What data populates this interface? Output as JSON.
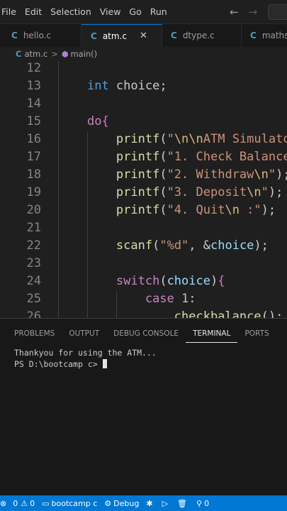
{
  "menu": [
    "File",
    "Edit",
    "Selection",
    "View",
    "Go",
    "Run"
  ],
  "nav": {
    "back_icon": "arrow-left-icon",
    "forward_icon": "arrow-right-icon"
  },
  "tabs": [
    {
      "label": "hello.c",
      "icon": "C",
      "active": false
    },
    {
      "label": "atm.c",
      "icon": "C",
      "active": true,
      "close": "✕"
    },
    {
      "label": "dtype.c",
      "icon": "C",
      "active": false
    },
    {
      "label": "mathss",
      "icon": "C",
      "active": false
    }
  ],
  "breadcrumb": {
    "file": "atm.c",
    "file_icon": "C",
    "symbol": "main()"
  },
  "editor": {
    "lines": [
      {
        "num": "12",
        "tokens": []
      },
      {
        "num": "13",
        "tokens": [
          [
            "    ",
            "p"
          ],
          [
            "int",
            "kw"
          ],
          [
            " choice;",
            "p"
          ]
        ]
      },
      {
        "num": "14",
        "tokens": []
      },
      {
        "num": "15",
        "tokens": [
          [
            "    ",
            "p"
          ],
          [
            "do",
            "ctrl"
          ],
          [
            "{",
            "br"
          ]
        ]
      },
      {
        "num": "16",
        "tokens": [
          [
            "        ",
            "p"
          ],
          [
            "printf",
            "fn"
          ],
          [
            "(",
            "p"
          ],
          [
            "\"",
            "str"
          ],
          [
            "\\n\\n",
            "esc"
          ],
          [
            "ATM Simulator",
            "str"
          ]
        ]
      },
      {
        "num": "17",
        "tokens": [
          [
            "        ",
            "p"
          ],
          [
            "printf",
            "fn"
          ],
          [
            "(",
            "p"
          ],
          [
            "\"1. Check Balance",
            "str"
          ]
        ]
      },
      {
        "num": "18",
        "tokens": [
          [
            "        ",
            "p"
          ],
          [
            "printf",
            "fn"
          ],
          [
            "(",
            "p"
          ],
          [
            "\"2. Withdraw",
            "str"
          ],
          [
            "\\n",
            "esc"
          ],
          [
            "\"",
            "str"
          ],
          [
            ");",
            "p"
          ]
        ]
      },
      {
        "num": "19",
        "tokens": [
          [
            "        ",
            "p"
          ],
          [
            "printf",
            "fn"
          ],
          [
            "(",
            "p"
          ],
          [
            "\"3. Deposit",
            "str"
          ],
          [
            "\\n",
            "esc"
          ],
          [
            "\"",
            "str"
          ],
          [
            ");",
            "p"
          ]
        ]
      },
      {
        "num": "20",
        "tokens": [
          [
            "        ",
            "p"
          ],
          [
            "printf",
            "fn"
          ],
          [
            "(",
            "p"
          ],
          [
            "\"4. Quit",
            "str"
          ],
          [
            "\\n",
            "esc"
          ],
          [
            " :\"",
            "str"
          ],
          [
            ");",
            "p"
          ]
        ]
      },
      {
        "num": "21",
        "tokens": []
      },
      {
        "num": "22",
        "tokens": [
          [
            "        ",
            "p"
          ],
          [
            "scanf",
            "fn"
          ],
          [
            "(",
            "p"
          ],
          [
            "\"%d\"",
            "str"
          ],
          [
            ", &",
            "p"
          ],
          [
            "choice",
            "var"
          ],
          [
            ");",
            "p"
          ]
        ]
      },
      {
        "num": "23",
        "tokens": []
      },
      {
        "num": "24",
        "tokens": [
          [
            "        ",
            "p"
          ],
          [
            "switch",
            "ctrl"
          ],
          [
            "(",
            "p"
          ],
          [
            "choice",
            "var"
          ],
          [
            ")",
            "p"
          ],
          [
            "{",
            "br"
          ]
        ]
      },
      {
        "num": "25",
        "tokens": [
          [
            "            ",
            "p"
          ],
          [
            "case",
            "ctrl"
          ],
          [
            " ",
            "p"
          ],
          [
            "1",
            "num"
          ],
          [
            ":",
            "p"
          ]
        ]
      },
      {
        "num": "26",
        "tokens": [
          [
            "                ",
            "p"
          ],
          [
            "checkbalance",
            "fn"
          ],
          [
            "();",
            "p"
          ]
        ]
      }
    ]
  },
  "panel": {
    "tabs": [
      {
        "label": "PROBLEMS",
        "active": false
      },
      {
        "label": "OUTPUT",
        "active": false
      },
      {
        "label": "DEBUG CONSOLE",
        "active": false
      },
      {
        "label": "TERMINAL",
        "active": true
      },
      {
        "label": "PORTS",
        "active": false
      }
    ],
    "terminal": {
      "line1": "Thankyou for using the ATM...",
      "prompt": "PS D:\\bootcamp c> "
    }
  },
  "statusbar": {
    "remote_icon": "remote-icon",
    "errors": "0",
    "warnings": "0",
    "folder": "bootcamp c",
    "debug": "Debug",
    "ports": "0"
  },
  "colors": {
    "status_bar": "#0078d4",
    "editor_bg": "#1f1f1f",
    "keyword": "#569cd6",
    "control": "#c586c0",
    "function": "#dcdcaa",
    "string": "#ce9178"
  }
}
